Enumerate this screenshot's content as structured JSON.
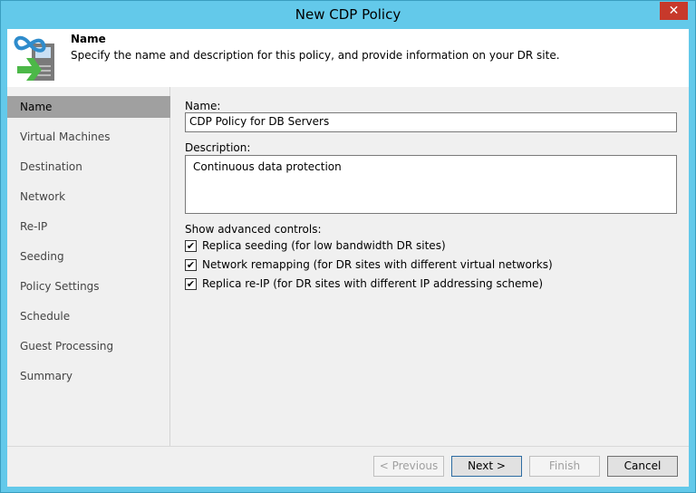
{
  "window": {
    "title": "New CDP Policy",
    "close": "✕"
  },
  "header": {
    "title": "Name",
    "description": "Specify the name and description for this policy, and provide information on your DR site."
  },
  "sidebar": {
    "items": [
      {
        "label": "Name"
      },
      {
        "label": "Virtual Machines"
      },
      {
        "label": "Destination"
      },
      {
        "label": "Network"
      },
      {
        "label": "Re-IP"
      },
      {
        "label": "Seeding"
      },
      {
        "label": "Policy Settings"
      },
      {
        "label": "Schedule"
      },
      {
        "label": "Guest Processing"
      },
      {
        "label": "Summary"
      }
    ]
  },
  "form": {
    "name_label": "Name:",
    "name_value": "CDP Policy for DB Servers",
    "desc_label": "Description:",
    "desc_value": "Continuous data protection",
    "advanced_label": "Show advanced controls:",
    "checks": [
      {
        "label": "Replica seeding (for low bandwidth DR sites)",
        "checked": true
      },
      {
        "label": "Network remapping (for DR sites with different virtual networks)",
        "checked": true
      },
      {
        "label": "Replica re-IP (for DR sites with different IP addressing scheme)",
        "checked": true
      }
    ],
    "check_mark": "✔"
  },
  "footer": {
    "previous": "< Previous",
    "next": "Next >",
    "finish": "Finish",
    "cancel": "Cancel"
  }
}
